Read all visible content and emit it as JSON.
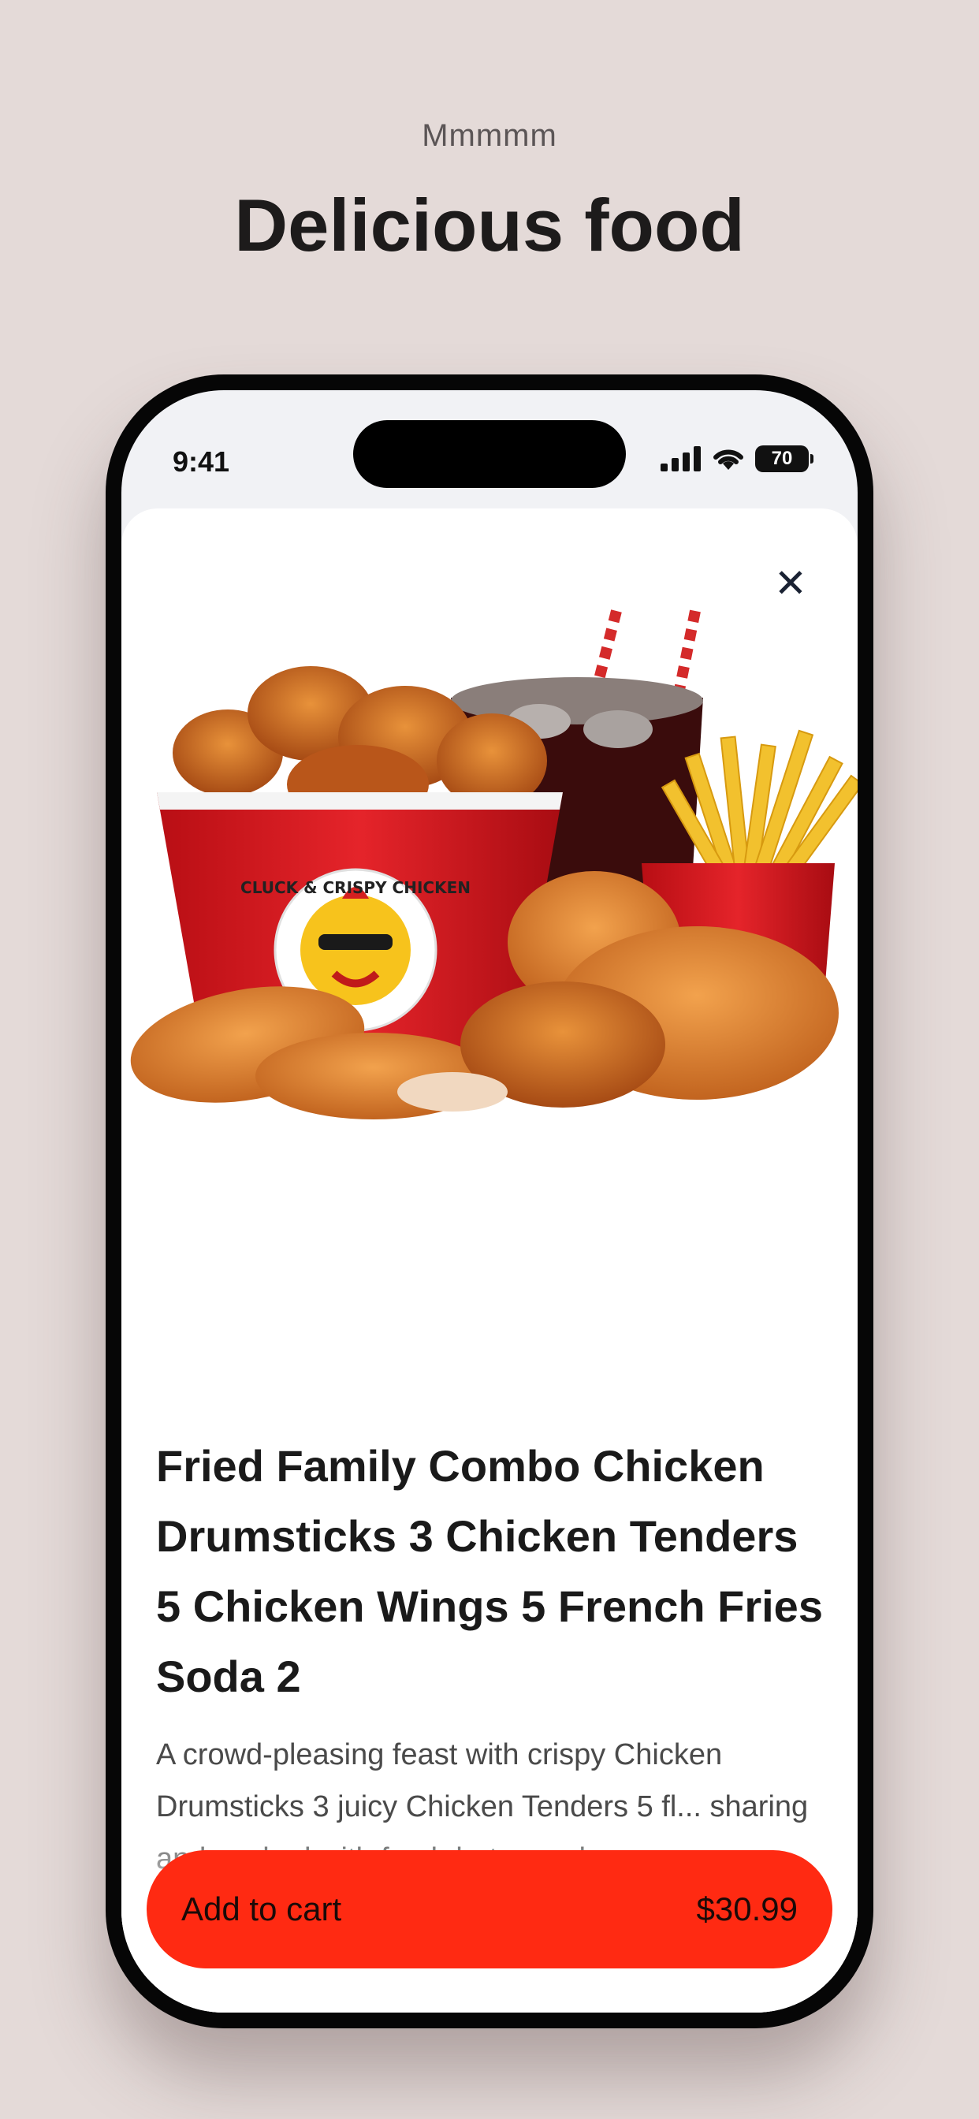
{
  "header": {
    "eyebrow": "Mmmmm",
    "headline": "Delicious food"
  },
  "status_bar": {
    "time": "9:41",
    "battery": "70"
  },
  "icons": {
    "close": "close-icon",
    "signal": "cellular-signal-icon",
    "wifi": "wifi-icon",
    "battery": "battery-icon"
  },
  "hero_image": {
    "logo_text": "CLUCK & CRISPY CHICKEN"
  },
  "product": {
    "title": "Fried Family Combo Chicken Drumsticks 3 Chicken Tenders 5 Chicken Wings 5 French Fries Soda 2",
    "description": "A crowd-pleasing feast with crispy Chicken Drumsticks 3 juicy Chicken Tenders 5 fl... sharing and packed with fresh hot crunchy"
  },
  "cart": {
    "label": "Add to cart",
    "price": "$30.99"
  },
  "colors": {
    "background": "#e4dad8",
    "accent": "#ff2a12",
    "bucket_red": "#d8161b"
  }
}
